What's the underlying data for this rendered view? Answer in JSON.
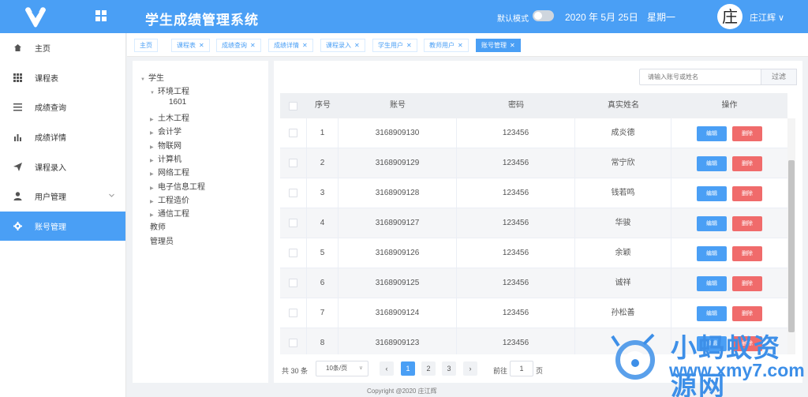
{
  "header": {
    "title": "学生成绩管理系统",
    "dark_mode_label": "默认模式",
    "date": "2020 年 5月 25日",
    "weekday": "星期一",
    "avatar_char": "庄",
    "user_name": "庄江辉 ∨"
  },
  "sidebar": {
    "items": [
      {
        "label": "主页",
        "icon": "home-icon"
      },
      {
        "label": "课程表",
        "icon": "grid-icon"
      },
      {
        "label": "成绩查询",
        "icon": "list-icon"
      },
      {
        "label": "成绩详情",
        "icon": "bar-chart-icon"
      },
      {
        "label": "课程录入",
        "icon": "send-icon"
      },
      {
        "label": "用户管理",
        "icon": "user-icon"
      },
      {
        "label": "账号管理",
        "icon": "gear-icon"
      }
    ],
    "active_index": 6
  },
  "tabs": [
    {
      "label": "主页",
      "closable": false
    },
    {
      "label": "课程表",
      "closable": true
    },
    {
      "label": "成绩查询",
      "closable": true
    },
    {
      "label": "成绩详情",
      "closable": true
    },
    {
      "label": "课程录入",
      "closable": true
    },
    {
      "label": "学生用户",
      "closable": true
    },
    {
      "label": "教师用户",
      "closable": true
    },
    {
      "label": "账号管理",
      "closable": true
    }
  ],
  "tree": {
    "root": "学生",
    "expanded": "环境工程",
    "leaf": "1601",
    "children": [
      "土木工程",
      "会计学",
      "物联网",
      "计算机",
      "网络工程",
      "电子信息工程",
      "工程造价",
      "通信工程"
    ],
    "others": [
      "教师",
      "管理员"
    ]
  },
  "search": {
    "placeholder": "请输入账号或姓名",
    "button": "过滤"
  },
  "table": {
    "headers": [
      "序号",
      "账号",
      "密码",
      "真实姓名",
      "操作"
    ],
    "rows": [
      {
        "no": "1",
        "account": "3168909130",
        "password": "123456",
        "name": "成炎德"
      },
      {
        "no": "2",
        "account": "3168909129",
        "password": "123456",
        "name": "常宁欣"
      },
      {
        "no": "3",
        "account": "3168909128",
        "password": "123456",
        "name": "钱若鸣"
      },
      {
        "no": "4",
        "account": "3168909127",
        "password": "123456",
        "name": "华骏"
      },
      {
        "no": "5",
        "account": "3168909126",
        "password": "123456",
        "name": "余颖"
      },
      {
        "no": "6",
        "account": "3168909125",
        "password": "123456",
        "name": "诚祥"
      },
      {
        "no": "7",
        "account": "3168909124",
        "password": "123456",
        "name": "孙松善"
      },
      {
        "no": "8",
        "account": "3168909123",
        "password": "123456",
        "name": ""
      }
    ],
    "edit_label": "编辑",
    "delete_label": "删除"
  },
  "pagination": {
    "total": "共 30 条",
    "page_size": "10条/页",
    "pages": [
      "1",
      "2",
      "3"
    ],
    "current": "1",
    "goto_label": "前往",
    "goto_value": "1",
    "goto_unit": "页"
  },
  "footer": {
    "copyright": "Copyright @2020 庄江辉"
  },
  "watermark": {
    "text": "小蚂蚁资源网",
    "url": "www.xmy7.com"
  },
  "colors": {
    "primary": "#4a9ff5",
    "danger": "#f06b6b",
    "background": "#f0f2f5"
  }
}
